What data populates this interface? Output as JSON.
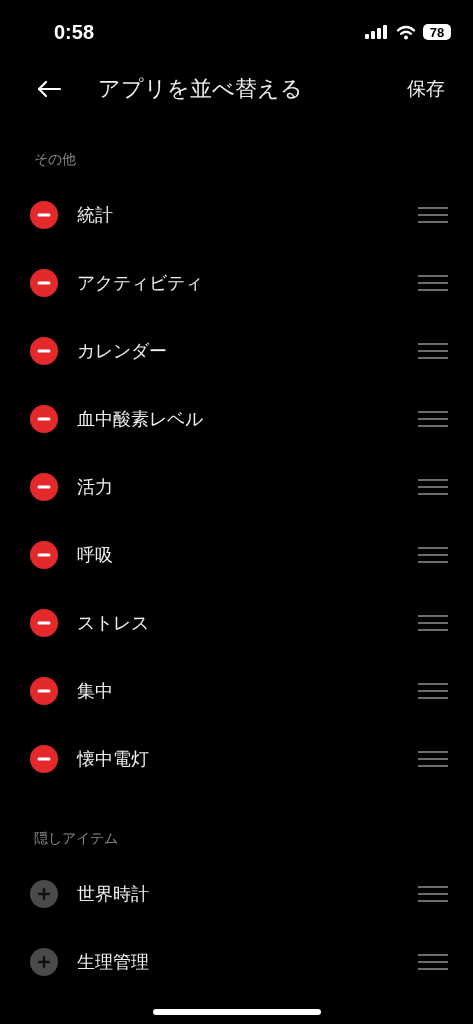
{
  "status_bar": {
    "time": "0:58",
    "battery": "78"
  },
  "header": {
    "title": "アプリを並べ替える",
    "save": "保存"
  },
  "sections": [
    {
      "title": "その他",
      "items": [
        {
          "label": "統計",
          "kind": "remove"
        },
        {
          "label": "アクティビティ",
          "kind": "remove"
        },
        {
          "label": "カレンダー",
          "kind": "remove"
        },
        {
          "label": "血中酸素レベル",
          "kind": "remove"
        },
        {
          "label": "活力",
          "kind": "remove"
        },
        {
          "label": "呼吸",
          "kind": "remove"
        },
        {
          "label": "ストレス",
          "kind": "remove"
        },
        {
          "label": "集中",
          "kind": "remove"
        },
        {
          "label": "懐中電灯",
          "kind": "remove"
        }
      ]
    },
    {
      "title": "隠しアイテム",
      "items": [
        {
          "label": "世界時計",
          "kind": "add"
        },
        {
          "label": "生理管理",
          "kind": "add"
        }
      ]
    }
  ]
}
